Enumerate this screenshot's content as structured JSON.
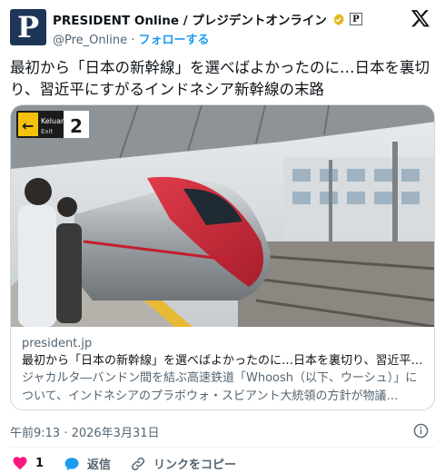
{
  "author": {
    "avatar_letter": "P",
    "display_name": "PRESIDENT Online / プレジデントオンライン",
    "affiliate_badge": "P",
    "handle": "@Pre_Online",
    "separator": "·",
    "follow_label": "フォローする"
  },
  "tweet": {
    "text": "最初から「日本の新幹線」を選べばよかったのに…日本を裏切り、習近平にすがるインドネシア新幹線の末路"
  },
  "link_card": {
    "station_sign": {
      "arrow": "←",
      "exit_local": "Keluar",
      "exit_en": "Exit",
      "number": "2"
    },
    "domain": "president.jp",
    "title": "最初から「日本の新幹線」を選べばよかったのに…日本を裏切り、習近平…",
    "description": "ジャカルタ―バンドン間を結ぶ高速鉄道「Whoosh（以下、ウーシュ）」について、インドネシアのプラボウォ・スビアント大統領の方針が物議…"
  },
  "timestamp": "午前9:13 · 2026年3月31日",
  "actions": {
    "like_count": "1",
    "reply_label": "返信",
    "copy_link_label": "リンクをコピー"
  },
  "colors": {
    "accent": "#1d9bf0",
    "like": "#f91880",
    "verified_gold": "#e2b719",
    "muted_text": "#536471",
    "border": "#cfd9de"
  },
  "icons": [
    "verified-gold-icon",
    "x-logo-icon",
    "info-icon",
    "heart-icon",
    "reply-bubble-icon",
    "link-icon"
  ]
}
